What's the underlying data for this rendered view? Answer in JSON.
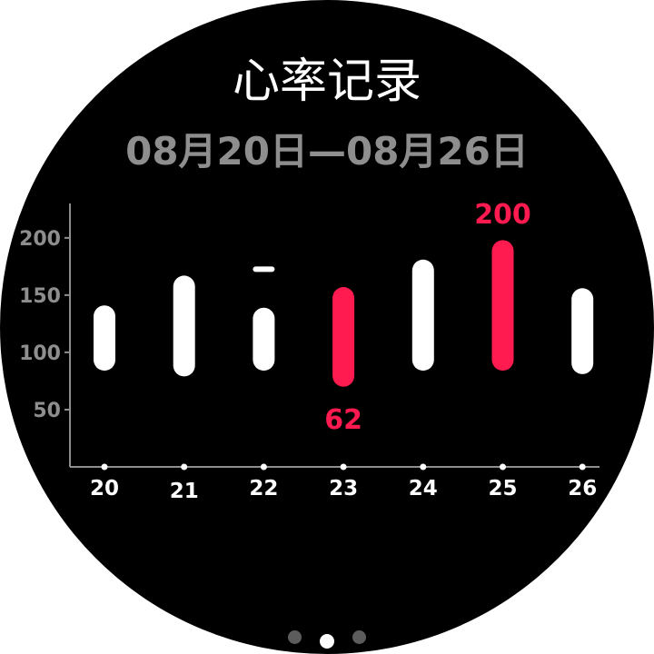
{
  "header": {
    "title": "心率记录",
    "date_range": "08月20日—08月26日"
  },
  "chart_data": {
    "type": "bar",
    "categories": [
      "20",
      "21",
      "22",
      "23",
      "24",
      "25",
      "26"
    ],
    "ylim": [
      0,
      230
    ],
    "yticks": [
      50,
      100,
      150,
      200
    ],
    "ranges": [
      {
        "day": "20",
        "segments": [
          [
            84,
            141
          ]
        ],
        "highlight": false
      },
      {
        "day": "21",
        "segments": [
          [
            79,
            167
          ]
        ],
        "highlight": false
      },
      {
        "day": "22",
        "segments": [
          [
            84,
            139
          ],
          [
            172,
            175
          ]
        ],
        "highlight": false
      },
      {
        "day": "23",
        "segments": [
          [
            70,
            157
          ]
        ],
        "highlight": true
      },
      {
        "day": "24",
        "segments": [
          [
            84,
            181
          ]
        ],
        "highlight": false
      },
      {
        "day": "25",
        "segments": [
          [
            84,
            198
          ]
        ],
        "highlight": true
      },
      {
        "day": "26",
        "segments": [
          [
            81,
            156
          ]
        ],
        "highlight": false
      }
    ],
    "annotations": [
      {
        "day": "23",
        "value": 62,
        "label": "62",
        "position": "below"
      },
      {
        "day": "25",
        "value": 200,
        "label": "200",
        "position": "above"
      }
    ],
    "colors": {
      "bar": "#ffffff",
      "highlight": "#ff1a4f",
      "axis": "#8e8e8e",
      "tick_label": "#8e8e8e",
      "x_label": "#ffffff"
    }
  },
  "pager": {
    "count": 3,
    "active_index": 1
  }
}
